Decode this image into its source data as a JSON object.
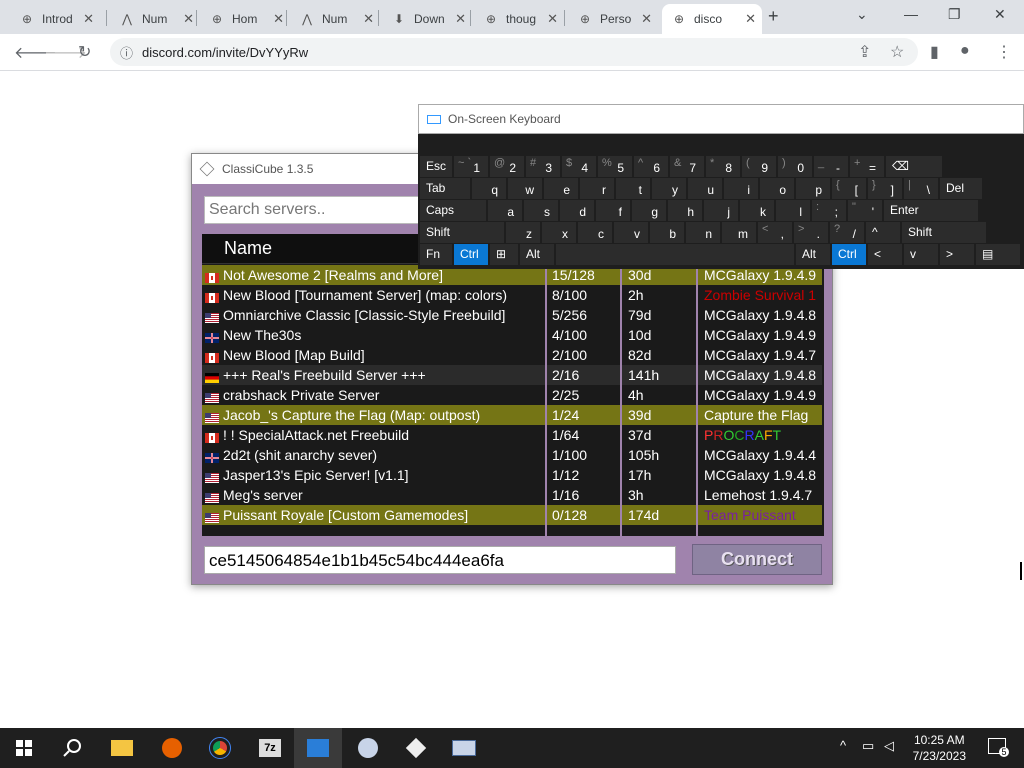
{
  "browser": {
    "tabs": [
      {
        "title": "Introd",
        "icon": "globe-icon"
      },
      {
        "title": "Num",
        "icon": "github-icon"
      },
      {
        "title": "Hom",
        "icon": "globe-icon"
      },
      {
        "title": "Num",
        "icon": "github-icon"
      },
      {
        "title": "Down",
        "icon": "download-icon"
      },
      {
        "title": "thoug",
        "icon": "globe-icon"
      },
      {
        "title": "Perso",
        "icon": "globe-icon"
      },
      {
        "title": "disco",
        "icon": "globe-icon"
      }
    ],
    "url": "discord.com/invite/DvYYyRw"
  },
  "classicube": {
    "title": "ClassiCube 1.3.5",
    "search_placeholder": "Search servers..",
    "column_name": "Name",
    "hash_value": "ce5145064854e1b1b45c54bc444ea6fa",
    "connect_label": "Connect",
    "servers": [
      {
        "name": "Not Awesome 2 [Realms and More]",
        "players": "15/128",
        "uptime": "30d",
        "software": "MCGalaxy 1.9.4.9",
        "flag": "ca",
        "hl": "hl"
      },
      {
        "name": "New Blood [Tournament Server] (map: colors)",
        "players": "8/100",
        "uptime": "2h",
        "software": "Zombie Survival 1",
        "flag": "ca",
        "sw_color": "#cc0000"
      },
      {
        "name": "Omniarchive Classic [Classic-Style Freebuild]",
        "players": "5/256",
        "uptime": "79d",
        "software": "MCGalaxy 1.9.4.8",
        "flag": "us"
      },
      {
        "name": "New The30s",
        "players": "4/100",
        "uptime": "10d",
        "software": "MCGalaxy 1.9.4.9",
        "flag": "gb"
      },
      {
        "name": "New Blood [Map Build]",
        "players": "2/100",
        "uptime": "82d",
        "software": "MCGalaxy 1.9.4.7",
        "flag": "ca"
      },
      {
        "name": "+++ Real's Freebuild Server +++",
        "players": "2/16",
        "uptime": "141h",
        "software": "MCGalaxy 1.9.4.8",
        "flag": "de",
        "hl": "hov"
      },
      {
        "name": "crabshack  Private Server",
        "players": "2/25",
        "uptime": "4h",
        "software": "MCGalaxy 1.9.4.9",
        "flag": "us"
      },
      {
        "name": "Jacob_'s Capture the Flag (Map: outpost)",
        "players": "1/24",
        "uptime": "39d",
        "software": "Capture the Flag",
        "flag": "us",
        "hl": "hl"
      },
      {
        "name": "! ! SpecialAttack.net Freebuild",
        "players": "1/64",
        "uptime": "37d",
        "software": "PROCRAFT",
        "flag": "ca",
        "rainbow": true
      },
      {
        "name": "2d2t (shit anarchy sever)",
        "players": "1/100",
        "uptime": "105h",
        "software": "MCGalaxy 1.9.4.4",
        "flag": "gb"
      },
      {
        "name": "Jasper13's Epic Server! [v1.1]",
        "players": "1/12",
        "uptime": "17h",
        "software": "MCGalaxy 1.9.4.8",
        "flag": "us"
      },
      {
        "name": "Meg's server",
        "players": "1/16",
        "uptime": "3h",
        "software": "Lemehost 1.9.4.7",
        "flag": "us"
      },
      {
        "name": "Puissant Royale [Custom Gamemodes]",
        "players": "0/128",
        "uptime": "174d",
        "software": "Team Puissant",
        "flag": "us",
        "hl": "hl",
        "sw_color": "#7a1fa0"
      }
    ]
  },
  "osk": {
    "title": "On-Screen Keyboard",
    "rows": [
      [
        {
          "l": "Esc",
          "w": 34
        },
        {
          "s": "~ `",
          "m": "1",
          "w": 36
        },
        {
          "s": "@",
          "m": "2",
          "w": 36
        },
        {
          "s": "#",
          "m": "3",
          "w": 36
        },
        {
          "s": "$",
          "m": "4",
          "w": 36
        },
        {
          "s": "%",
          "m": "5",
          "w": 36
        },
        {
          "s": "^",
          "m": "6",
          "w": 36
        },
        {
          "s": "&",
          "m": "7",
          "w": 36
        },
        {
          "s": "*",
          "m": "8",
          "w": 36
        },
        {
          "s": "(",
          "m": "9",
          "w": 36
        },
        {
          "s": ")",
          "m": "0",
          "w": 36
        },
        {
          "s": "_",
          "m": "-",
          "w": 36
        },
        {
          "s": "+",
          "m": "=",
          "w": 36
        },
        {
          "l": "⌫",
          "w": 58
        }
      ],
      [
        {
          "l": "Tab",
          "w": 52
        },
        {
          "m": "q",
          "w": 36
        },
        {
          "m": "w",
          "w": 36
        },
        {
          "m": "e",
          "w": 36
        },
        {
          "m": "r",
          "w": 36
        },
        {
          "m": "t",
          "w": 36
        },
        {
          "m": "y",
          "w": 36
        },
        {
          "m": "u",
          "w": 36
        },
        {
          "m": "i",
          "w": 36
        },
        {
          "m": "o",
          "w": 36
        },
        {
          "m": "p",
          "w": 36
        },
        {
          "s": "{",
          "m": "[",
          "w": 36
        },
        {
          "s": "}",
          "m": "]",
          "w": 36
        },
        {
          "s": "|",
          "m": "\\",
          "w": 36
        },
        {
          "l": "Del",
          "w": 44
        }
      ],
      [
        {
          "l": "Caps",
          "w": 68
        },
        {
          "m": "a",
          "w": 36
        },
        {
          "m": "s",
          "w": 36
        },
        {
          "m": "d",
          "w": 36
        },
        {
          "m": "f",
          "w": 36
        },
        {
          "m": "g",
          "w": 36
        },
        {
          "m": "h",
          "w": 36
        },
        {
          "m": "j",
          "w": 36
        },
        {
          "m": "k",
          "w": 36
        },
        {
          "m": "l",
          "w": 36
        },
        {
          "s": ":",
          "m": ";",
          "w": 36
        },
        {
          "s": "\"",
          "m": "'",
          "w": 36
        },
        {
          "l": "Enter",
          "w": 96
        }
      ],
      [
        {
          "l": "Shift",
          "w": 86
        },
        {
          "m": "z",
          "w": 36
        },
        {
          "m": "x",
          "w": 36
        },
        {
          "m": "c",
          "w": 36
        },
        {
          "m": "v",
          "w": 36
        },
        {
          "m": "b",
          "w": 36
        },
        {
          "m": "n",
          "w": 36
        },
        {
          "m": "m",
          "w": 36
        },
        {
          "s": "<",
          "m": ",",
          "w": 36
        },
        {
          "s": ">",
          "m": ".",
          "w": 36
        },
        {
          "s": "?",
          "m": "/",
          "w": 36
        },
        {
          "l": "^",
          "w": 36
        },
        {
          "l": "Shift",
          "w": 86
        }
      ],
      [
        {
          "l": "Fn",
          "w": 34
        },
        {
          "l": "Ctrl",
          "w": 36,
          "blue": true
        },
        {
          "l": "⊞",
          "w": 30
        },
        {
          "l": "Alt",
          "w": 36
        },
        {
          "l": "",
          "w": 240
        },
        {
          "l": "Alt",
          "w": 36
        },
        {
          "l": "Ctrl",
          "w": 36,
          "blue": true
        },
        {
          "l": "<",
          "w": 36
        },
        {
          "l": "v",
          "w": 36
        },
        {
          "l": ">",
          "w": 36
        },
        {
          "l": "▤",
          "w": 46
        }
      ]
    ]
  },
  "taskbar": {
    "time": "10:25 AM",
    "date": "7/23/2023",
    "notification_count": "5"
  }
}
